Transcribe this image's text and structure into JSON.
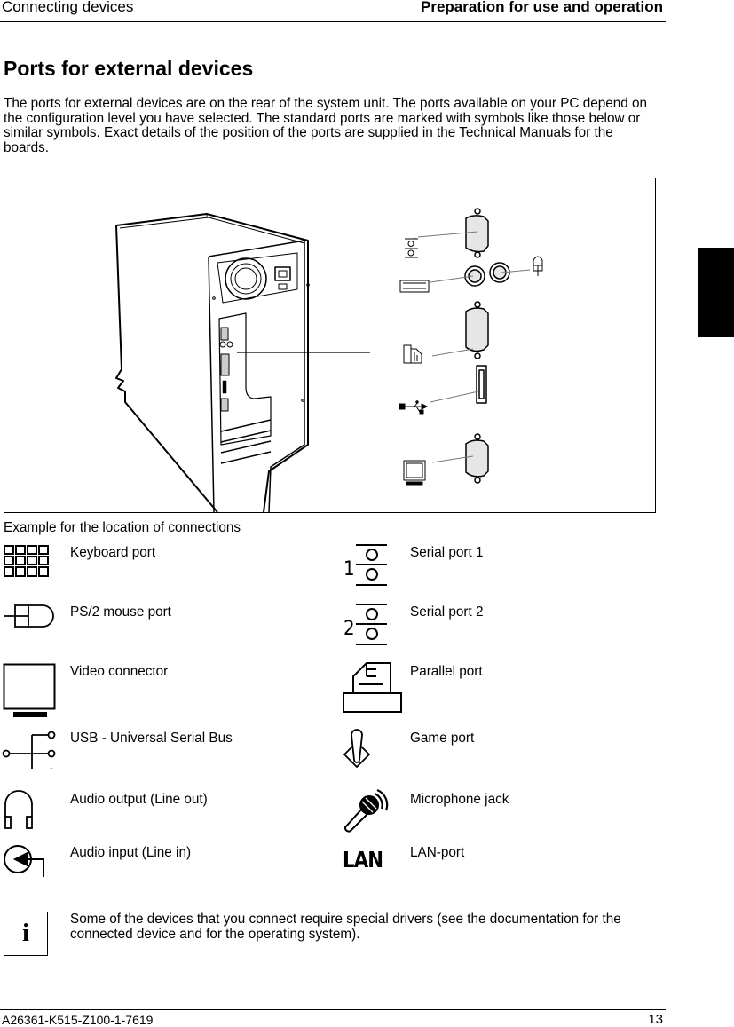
{
  "header": {
    "section": "Connecting devices",
    "chapter": "Preparation for use and operation"
  },
  "title": "Ports for external devices",
  "intro": "The ports for external devices are on the rear of the system unit. The ports available on your PC depend on the configuration level you have selected. The standard ports are marked with symbols like those below or similar symbols. Exact details of the position of the ports are supplied in the Technical Manuals for the boards.",
  "figure": {
    "caption": "Example for the location of connections",
    "connector_fill": "#e6e6e6"
  },
  "legend": {
    "left": [
      {
        "icon": "keyboard-icon",
        "label": "Keyboard port"
      },
      {
        "icon": "mouse-icon",
        "label": "PS/2 mouse port"
      },
      {
        "icon": "monitor-icon",
        "label": "Video connector"
      },
      {
        "icon": "usb-icon",
        "label": "USB - Universal Serial Bus"
      },
      {
        "icon": "headphones-icon",
        "label": "Audio output (Line out)"
      },
      {
        "icon": "line-in-icon",
        "label": "Audio input (Line in)"
      }
    ],
    "right": [
      {
        "icon": "serial-port-1-icon",
        "label": "Serial port 1",
        "digit": "1"
      },
      {
        "icon": "serial-port-2-icon",
        "label": "Serial port 2",
        "digit": "2"
      },
      {
        "icon": "printer-icon",
        "label": "Parallel port"
      },
      {
        "icon": "joystick-icon",
        "label": "Game port"
      },
      {
        "icon": "microphone-icon",
        "label": "Microphone jack"
      },
      {
        "icon": "lan-icon",
        "label": "LAN-port",
        "glyph": "LAN"
      }
    ]
  },
  "note": {
    "icon_glyph": "i",
    "text": "Some of the devices that you connect require special drivers (see the documentation for the connected device and for the operating system)."
  },
  "footer": {
    "doc_number": "A26361-K515-Z100-1-7619",
    "page_number": "13"
  }
}
